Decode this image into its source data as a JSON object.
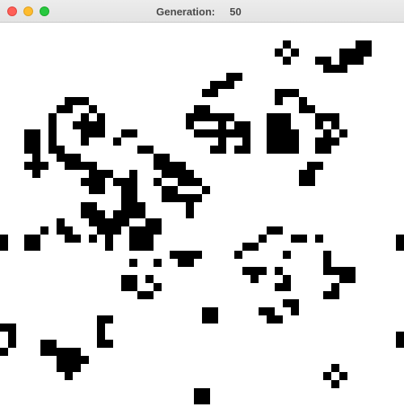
{
  "window": {
    "title_label": "Generation:",
    "generation": "50",
    "buttons": [
      "close",
      "minimize",
      "zoom"
    ]
  },
  "colors": {
    "live_cell": "#000000",
    "dead_cell": "#ffffff",
    "titlebar": "#e8e8e8",
    "close": "#ff5f57",
    "minimize": "#febc2e",
    "zoom": "#28c840"
  },
  "board": {
    "columns": 50,
    "rows": 47,
    "live_cells": [
      [
        35,
        2
      ],
      [
        34,
        3
      ],
      [
        36,
        3
      ],
      [
        35,
        4
      ],
      [
        44,
        2
      ],
      [
        45,
        2
      ],
      [
        42,
        3
      ],
      [
        43,
        3
      ],
      [
        44,
        3
      ],
      [
        45,
        3
      ],
      [
        39,
        4
      ],
      [
        40,
        4
      ],
      [
        42,
        4
      ],
      [
        43,
        4
      ],
      [
        44,
        4
      ],
      [
        40,
        5
      ],
      [
        41,
        5
      ],
      [
        42,
        5
      ],
      [
        28,
        6
      ],
      [
        29,
        6
      ],
      [
        26,
        7
      ],
      [
        27,
        7
      ],
      [
        28,
        7
      ],
      [
        25,
        8
      ],
      [
        26,
        8
      ],
      [
        24,
        10
      ],
      [
        25,
        10
      ],
      [
        23,
        11
      ],
      [
        24,
        11
      ],
      [
        25,
        11
      ],
      [
        26,
        11
      ],
      [
        27,
        11
      ],
      [
        28,
        11
      ],
      [
        23,
        12
      ],
      [
        27,
        12
      ],
      [
        29,
        12
      ],
      [
        30,
        12
      ],
      [
        24,
        13
      ],
      [
        25,
        13
      ],
      [
        26,
        13
      ],
      [
        27,
        13
      ],
      [
        28,
        13
      ],
      [
        29,
        13
      ],
      [
        30,
        13
      ],
      [
        27,
        14
      ],
      [
        30,
        14
      ],
      [
        26,
        15
      ],
      [
        27,
        15
      ],
      [
        29,
        15
      ],
      [
        30,
        15
      ],
      [
        34,
        8
      ],
      [
        35,
        8
      ],
      [
        36,
        8
      ],
      [
        34,
        9
      ],
      [
        37,
        9
      ],
      [
        37,
        10
      ],
      [
        38,
        10
      ],
      [
        33,
        11
      ],
      [
        34,
        11
      ],
      [
        35,
        11
      ],
      [
        33,
        12
      ],
      [
        34,
        12
      ],
      [
        35,
        12
      ],
      [
        33,
        13
      ],
      [
        34,
        13
      ],
      [
        35,
        13
      ],
      [
        36,
        13
      ],
      [
        33,
        14
      ],
      [
        34,
        14
      ],
      [
        35,
        14
      ],
      [
        36,
        14
      ],
      [
        33,
        15
      ],
      [
        34,
        15
      ],
      [
        35,
        15
      ],
      [
        36,
        15
      ],
      [
        39,
        11
      ],
      [
        40,
        11
      ],
      [
        41,
        11
      ],
      [
        39,
        12
      ],
      [
        41,
        12
      ],
      [
        40,
        13
      ],
      [
        42,
        13
      ],
      [
        39,
        14
      ],
      [
        40,
        14
      ],
      [
        41,
        14
      ],
      [
        39,
        15
      ],
      [
        40,
        15
      ],
      [
        38,
        17
      ],
      [
        39,
        17
      ],
      [
        37,
        18
      ],
      [
        38,
        18
      ],
      [
        37,
        19
      ],
      [
        38,
        19
      ],
      [
        8,
        9
      ],
      [
        9,
        9
      ],
      [
        10,
        9
      ],
      [
        7,
        10
      ],
      [
        8,
        10
      ],
      [
        11,
        10
      ],
      [
        6,
        11
      ],
      [
        10,
        11
      ],
      [
        12,
        11
      ],
      [
        6,
        12
      ],
      [
        9,
        12
      ],
      [
        10,
        12
      ],
      [
        11,
        12
      ],
      [
        12,
        12
      ],
      [
        6,
        13
      ],
      [
        10,
        13
      ],
      [
        11,
        13
      ],
      [
        12,
        13
      ],
      [
        15,
        13
      ],
      [
        16,
        13
      ],
      [
        3,
        13
      ],
      [
        4,
        13
      ],
      [
        3,
        14
      ],
      [
        4,
        14
      ],
      [
        6,
        14
      ],
      [
        10,
        14
      ],
      [
        14,
        14
      ],
      [
        3,
        15
      ],
      [
        4,
        15
      ],
      [
        6,
        15
      ],
      [
        7,
        15
      ],
      [
        17,
        15
      ],
      [
        18,
        15
      ],
      [
        4,
        16
      ],
      [
        7,
        16
      ],
      [
        8,
        16
      ],
      [
        9,
        16
      ],
      [
        19,
        16
      ],
      [
        20,
        16
      ],
      [
        3,
        17
      ],
      [
        4,
        17
      ],
      [
        5,
        17
      ],
      [
        8,
        17
      ],
      [
        9,
        17
      ],
      [
        10,
        17
      ],
      [
        11,
        17
      ],
      [
        19,
        17
      ],
      [
        20,
        17
      ],
      [
        21,
        17
      ],
      [
        22,
        17
      ],
      [
        4,
        18
      ],
      [
        11,
        18
      ],
      [
        12,
        18
      ],
      [
        13,
        18
      ],
      [
        16,
        18
      ],
      [
        20,
        18
      ],
      [
        21,
        18
      ],
      [
        22,
        18
      ],
      [
        23,
        18
      ],
      [
        10,
        19
      ],
      [
        11,
        19
      ],
      [
        12,
        19
      ],
      [
        14,
        19
      ],
      [
        15,
        19
      ],
      [
        16,
        19
      ],
      [
        19,
        19
      ],
      [
        22,
        19
      ],
      [
        23,
        19
      ],
      [
        24,
        19
      ],
      [
        11,
        20
      ],
      [
        12,
        20
      ],
      [
        15,
        20
      ],
      [
        16,
        20
      ],
      [
        20,
        20
      ],
      [
        21,
        20
      ],
      [
        25,
        20
      ],
      [
        15,
        21
      ],
      [
        16,
        21
      ],
      [
        20,
        21
      ],
      [
        21,
        21
      ],
      [
        22,
        21
      ],
      [
        23,
        21
      ],
      [
        24,
        21
      ],
      [
        10,
        22
      ],
      [
        11,
        22
      ],
      [
        15,
        22
      ],
      [
        16,
        22
      ],
      [
        17,
        22
      ],
      [
        23,
        22
      ],
      [
        10,
        23
      ],
      [
        11,
        23
      ],
      [
        12,
        23
      ],
      [
        14,
        23
      ],
      [
        15,
        23
      ],
      [
        16,
        23
      ],
      [
        17,
        23
      ],
      [
        23,
        23
      ],
      [
        7,
        24
      ],
      [
        11,
        24
      ],
      [
        12,
        24
      ],
      [
        13,
        24
      ],
      [
        14,
        24
      ],
      [
        15,
        24
      ],
      [
        18,
        24
      ],
      [
        19,
        24
      ],
      [
        5,
        25
      ],
      [
        7,
        25
      ],
      [
        8,
        25
      ],
      [
        12,
        25
      ],
      [
        13,
        25
      ],
      [
        14,
        25
      ],
      [
        16,
        25
      ],
      [
        17,
        25
      ],
      [
        18,
        25
      ],
      [
        19,
        25
      ],
      [
        0,
        26
      ],
      [
        3,
        26
      ],
      [
        4,
        26
      ],
      [
        8,
        26
      ],
      [
        9,
        26
      ],
      [
        11,
        26
      ],
      [
        13,
        26
      ],
      [
        16,
        26
      ],
      [
        17,
        26
      ],
      [
        18,
        26
      ],
      [
        0,
        27
      ],
      [
        3,
        27
      ],
      [
        4,
        27
      ],
      [
        13,
        27
      ],
      [
        16,
        27
      ],
      [
        17,
        27
      ],
      [
        18,
        27
      ],
      [
        33,
        25
      ],
      [
        34,
        25
      ],
      [
        32,
        26
      ],
      [
        36,
        26
      ],
      [
        37,
        26
      ],
      [
        39,
        26
      ],
      [
        30,
        27
      ],
      [
        31,
        27
      ],
      [
        49,
        26
      ],
      [
        49,
        27
      ],
      [
        29,
        28
      ],
      [
        35,
        28
      ],
      [
        21,
        28
      ],
      [
        22,
        28
      ],
      [
        23,
        28
      ],
      [
        24,
        28
      ],
      [
        22,
        29
      ],
      [
        23,
        29
      ],
      [
        40,
        28
      ],
      [
        40,
        29
      ],
      [
        16,
        29
      ],
      [
        19,
        29
      ],
      [
        30,
        30
      ],
      [
        31,
        30
      ],
      [
        32,
        30
      ],
      [
        34,
        30
      ],
      [
        40,
        30
      ],
      [
        41,
        30
      ],
      [
        42,
        30
      ],
      [
        43,
        30
      ],
      [
        15,
        31
      ],
      [
        16,
        31
      ],
      [
        18,
        31
      ],
      [
        31,
        31
      ],
      [
        35,
        31
      ],
      [
        42,
        31
      ],
      [
        43,
        31
      ],
      [
        15,
        32
      ],
      [
        16,
        32
      ],
      [
        19,
        32
      ],
      [
        34,
        32
      ],
      [
        35,
        32
      ],
      [
        41,
        32
      ],
      [
        17,
        33
      ],
      [
        18,
        33
      ],
      [
        40,
        33
      ],
      [
        41,
        33
      ],
      [
        35,
        34
      ],
      [
        36,
        34
      ],
      [
        32,
        35
      ],
      [
        33,
        35
      ],
      [
        36,
        35
      ],
      [
        33,
        36
      ],
      [
        34,
        36
      ],
      [
        25,
        35
      ],
      [
        26,
        35
      ],
      [
        25,
        36
      ],
      [
        26,
        36
      ],
      [
        12,
        36
      ],
      [
        13,
        36
      ],
      [
        12,
        37
      ],
      [
        0,
        37
      ],
      [
        1,
        37
      ],
      [
        1,
        38
      ],
      [
        12,
        38
      ],
      [
        1,
        39
      ],
      [
        12,
        39
      ],
      [
        13,
        39
      ],
      [
        0,
        40
      ],
      [
        5,
        39
      ],
      [
        6,
        39
      ],
      [
        5,
        40
      ],
      [
        6,
        40
      ],
      [
        7,
        40
      ],
      [
        8,
        40
      ],
      [
        9,
        40
      ],
      [
        7,
        41
      ],
      [
        8,
        41
      ],
      [
        9,
        41
      ],
      [
        10,
        41
      ],
      [
        7,
        42
      ],
      [
        8,
        42
      ],
      [
        9,
        42
      ],
      [
        8,
        43
      ],
      [
        49,
        38
      ],
      [
        49,
        39
      ],
      [
        41,
        42
      ],
      [
        40,
        43
      ],
      [
        42,
        43
      ],
      [
        41,
        44
      ],
      [
        24,
        45
      ],
      [
        25,
        45
      ],
      [
        24,
        46
      ],
      [
        25,
        46
      ]
    ]
  }
}
